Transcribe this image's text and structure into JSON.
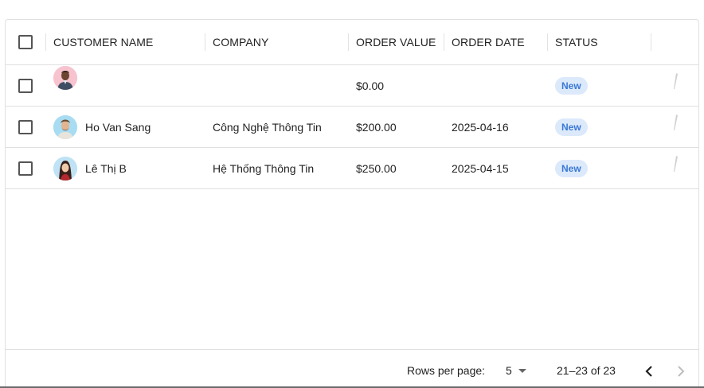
{
  "columns": {
    "customer_name": "CUSTOMER NAME",
    "company": "COMPANY",
    "order_value": "ORDER VALUE",
    "order_date": "ORDER DATE",
    "status": "STATUS"
  },
  "rows": [
    {
      "name": "",
      "company": "",
      "order_value": "$0.00",
      "order_date": "",
      "status": "New",
      "avatar": "man-avatar"
    },
    {
      "name": "Ho Van Sang",
      "company": "Công Nghệ Thông Tin",
      "order_value": "$200.00",
      "order_date": "2025-04-16",
      "status": "New",
      "avatar": "bearded-man-avatar"
    },
    {
      "name": "Lê Thị B",
      "company": "Hệ Thống Thông Tin",
      "order_value": "$250.00",
      "order_date": "2025-04-15",
      "status": "New",
      "avatar": "woman-avatar"
    }
  ],
  "pagination": {
    "rows_per_page_label": "Rows per page:",
    "rows_per_page_value": "5",
    "range_label": "21–23 of 23"
  },
  "colors": {
    "status_chip_bg": "#dbe9fb",
    "status_chip_text": "#3b78d4",
    "border": "#e0e0e0"
  },
  "icons": {
    "edit": "pencil-icon",
    "prev": "chevron-left-icon",
    "next": "chevron-right-icon",
    "dropdown": "caret-down-icon"
  }
}
